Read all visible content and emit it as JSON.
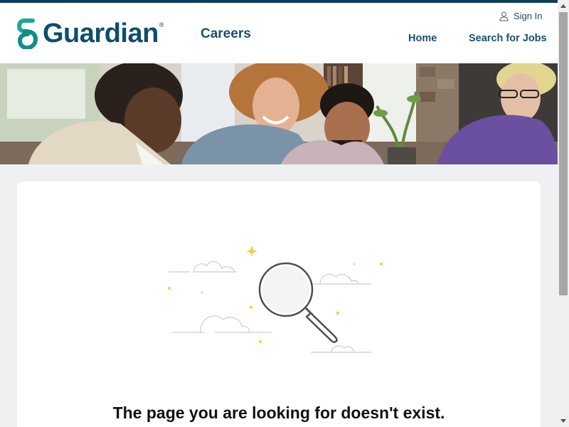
{
  "header": {
    "brand_name": "Guardian",
    "brand_mark": "®",
    "site_section": "Careers",
    "sign_in_label": "Sign In",
    "nav": [
      {
        "label": "Home"
      },
      {
        "label": "Search for Jobs"
      }
    ]
  },
  "hero": {
    "icon": "team-photo-banner"
  },
  "error": {
    "illustration_icon": "magnifying-glass-icon",
    "message": "The page you are looking for doesn't exist."
  },
  "colors": {
    "brand_teal": "#1aa79b",
    "brand_navy": "#0f4d6b",
    "top_strip": "#0b3f5c",
    "page_bg": "#eef0f2",
    "sparkle_yellow": "#f2cf4a"
  }
}
